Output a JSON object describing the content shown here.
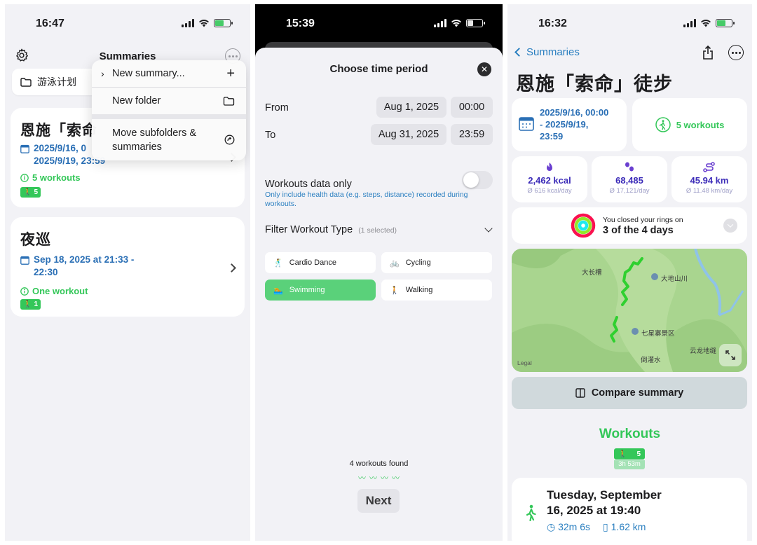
{
  "screen1": {
    "time": "16:47",
    "nav_title": "Summaries",
    "folder_chip": "游泳计划",
    "menu": {
      "new_summary": "New summary...",
      "new_folder": "New folder",
      "move_line1": "Move subfolders &",
      "move_line2": "summaries"
    },
    "card1": {
      "title": "恩施「索命",
      "date_line1": "2025/9/16, 0",
      "date_line2": "2025/9/19, 23:59",
      "workouts": "5 workouts",
      "badge_count": "5"
    },
    "card2": {
      "title": "夜巡",
      "date_line1": "Sep 18, 2025 at 21:33 -",
      "date_line2": "22:30",
      "workouts": "One workout",
      "badge_count": "1"
    }
  },
  "screen2": {
    "time": "15:39",
    "title": "Choose time period",
    "from_label": "From",
    "from_date": "Aug 1, 2025",
    "from_time": "00:00",
    "to_label": "To",
    "to_date": "Aug 31, 2025",
    "to_time": "23:59",
    "workouts_only_label": "Workouts data only",
    "workouts_only_hint": "Only include health data (e.g. steps, distance) recorded during workouts.",
    "filter_label": "Filter Workout Type",
    "filter_selected": "(1 selected)",
    "types": [
      "Cardio Dance",
      "Cycling",
      "Swimming",
      "Walking"
    ],
    "found_text": "4 workouts found",
    "next_label": "Next"
  },
  "screen3": {
    "time": "16:32",
    "back_label": "Summaries",
    "title": "恩施「索命」徒步",
    "date_line1": "2025/9/16, 00:00",
    "date_line2": "- 2025/9/19,",
    "date_line3": "23:59",
    "workouts": "5 workouts",
    "stats": [
      {
        "value": "2,462 kcal",
        "avg": "Ø 616 kcal/day"
      },
      {
        "value": "68,485",
        "avg": "Ø 17,121/day"
      },
      {
        "value": "45.94 km",
        "avg": "Ø 11.48 km/day"
      }
    ],
    "rings_line1": "You closed your rings on",
    "rings_line2": "3 of the 4 days",
    "map_labels": [
      "大长槽",
      "大地山川",
      "七星寨景区",
      "云龙地缝",
      "倒灌水"
    ],
    "map_legal": "Legal",
    "compare_label": "Compare summary",
    "workouts_heading": "Workouts",
    "badge_count": "5",
    "badge_duration": "3h 53m",
    "entry_line1": "Tuesday, September",
    "entry_line2": "16, 2025 at 19:40",
    "entry_duration": "32m 6s",
    "entry_distance": "1.62 km"
  },
  "colors": {
    "accent_blue": "#2a7fc0",
    "workout_green": "#34c759",
    "stat_purple": "#3b2bb8"
  }
}
